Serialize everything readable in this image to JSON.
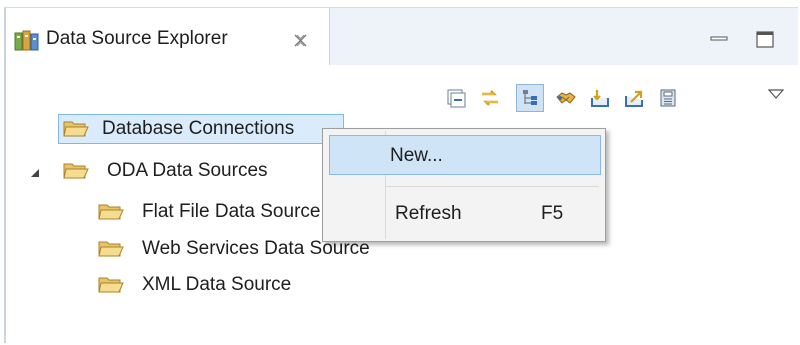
{
  "view": {
    "tab_title": "Data Source Explorer",
    "toolbar_icons": [
      "collapse-all-icon",
      "link-with-editor-icon",
      "tree-layout-icon",
      "handshake-icon",
      "import-icon",
      "export-icon",
      "save-icon"
    ]
  },
  "tree": {
    "items": [
      {
        "label": "Database Connections",
        "selected": true
      },
      {
        "label": "ODA Data Sources",
        "expanded": true
      },
      {
        "label": "Flat File Data Source"
      },
      {
        "label": "Web Services Data Source"
      },
      {
        "label": "XML Data Source"
      }
    ]
  },
  "context_menu": {
    "items": [
      {
        "label": "New...",
        "highlighted": true,
        "shortcut": ""
      },
      {
        "label": "Refresh",
        "shortcut": "F5"
      }
    ]
  },
  "colors": {
    "selection_bg": "#daecfb",
    "menu_highlight": "#d0e4f8",
    "folder": "#e8c36a"
  }
}
